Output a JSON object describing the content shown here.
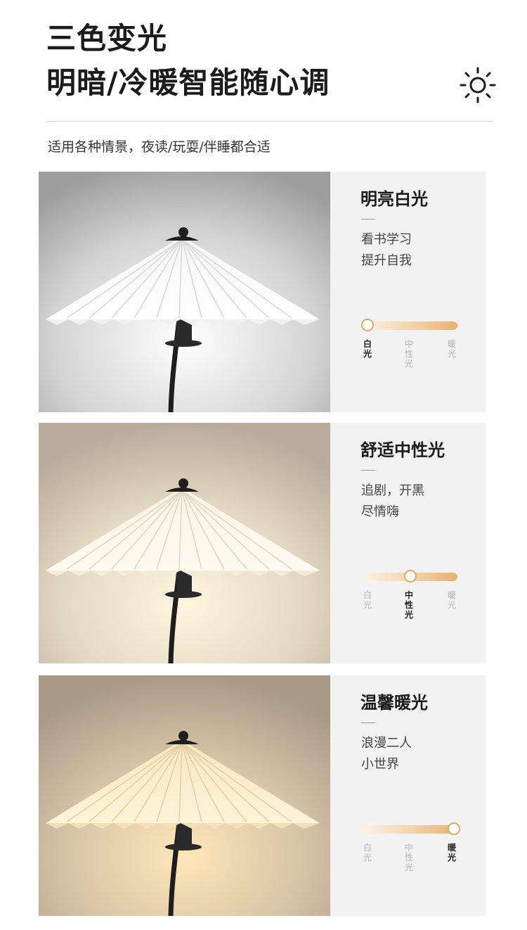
{
  "header": {
    "title_line1": "三色变光",
    "title_line2": "明暗/冷暖智能随心调",
    "subtitle": "适用各种情景，夜读/玩耍/伴睡都合适"
  },
  "icons": {
    "header_icon": "sun-icon"
  },
  "colors": {
    "accent": "#e3a860",
    "slider_start": "#fbf3e8",
    "slider_end": "#e9b170",
    "panel_bg": "#f2f2f2"
  },
  "slider_labels": {
    "white": "白光",
    "neutral": "中性光",
    "warm": "暖光"
  },
  "modes": [
    {
      "title": "明亮白光",
      "line1": "看书学习",
      "line2": "提升自我",
      "selected": "white",
      "position": 0.0
    },
    {
      "title": "舒适中性光",
      "line1": "追剧，开黑",
      "line2": "尽情嗨",
      "selected": "neutral",
      "position": 0.5
    },
    {
      "title": "温馨暖光",
      "line1": "浪漫二人",
      "line2": "小世界",
      "selected": "warm",
      "position": 1.0
    }
  ]
}
